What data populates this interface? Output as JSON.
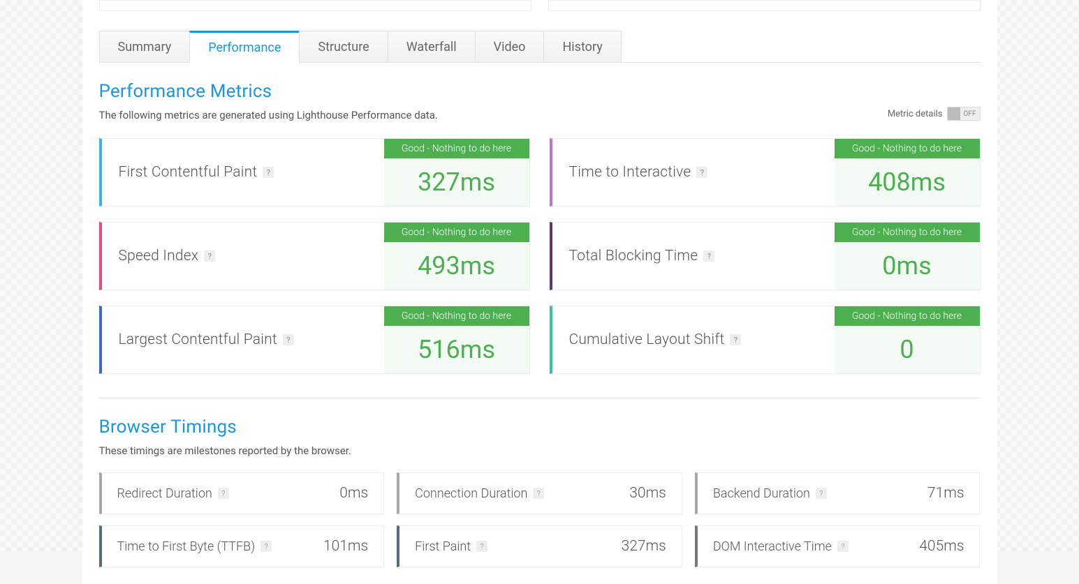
{
  "tabs": {
    "summary": "Summary",
    "performance": "Performance",
    "structure": "Structure",
    "waterfall": "Waterfall",
    "video": "Video",
    "history": "History"
  },
  "perf": {
    "title": "Performance Metrics",
    "subtitle": "The following metrics are generated using Lighthouse Performance data.",
    "metric_details_label": "Metric details",
    "toggle_state": "OFF",
    "status_good": "Good - Nothing to do here",
    "metrics": {
      "fcp": {
        "name": "First Contentful Paint",
        "value": "327ms"
      },
      "tti": {
        "name": "Time to Interactive",
        "value": "408ms"
      },
      "si": {
        "name": "Speed Index",
        "value": "493ms"
      },
      "tbt": {
        "name": "Total Blocking Time",
        "value": "0ms"
      },
      "lcp": {
        "name": "Largest Contentful Paint",
        "value": "516ms"
      },
      "cls": {
        "name": "Cumulative Layout Shift",
        "value": "0"
      }
    }
  },
  "timings": {
    "title": "Browser Timings",
    "subtitle": "These timings are milestones reported by the browser.",
    "items": {
      "redirect": {
        "name": "Redirect Duration",
        "value": "0ms"
      },
      "connection": {
        "name": "Connection Duration",
        "value": "30ms"
      },
      "backend": {
        "name": "Backend Duration",
        "value": "71ms"
      },
      "ttfb": {
        "name": "Time to First Byte (TTFB)",
        "value": "101ms"
      },
      "first_paint": {
        "name": "First Paint",
        "value": "327ms"
      },
      "dom_interactive": {
        "name": "DOM Interactive Time",
        "value": "405ms"
      }
    }
  }
}
